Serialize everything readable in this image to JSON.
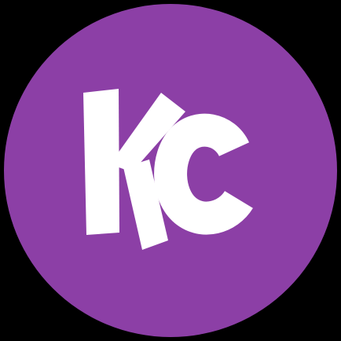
{
  "logo": {
    "lettering": "KC",
    "background_color": "#000000",
    "circle_color": "#8c3fa6",
    "letter_color": "#ffffff"
  }
}
